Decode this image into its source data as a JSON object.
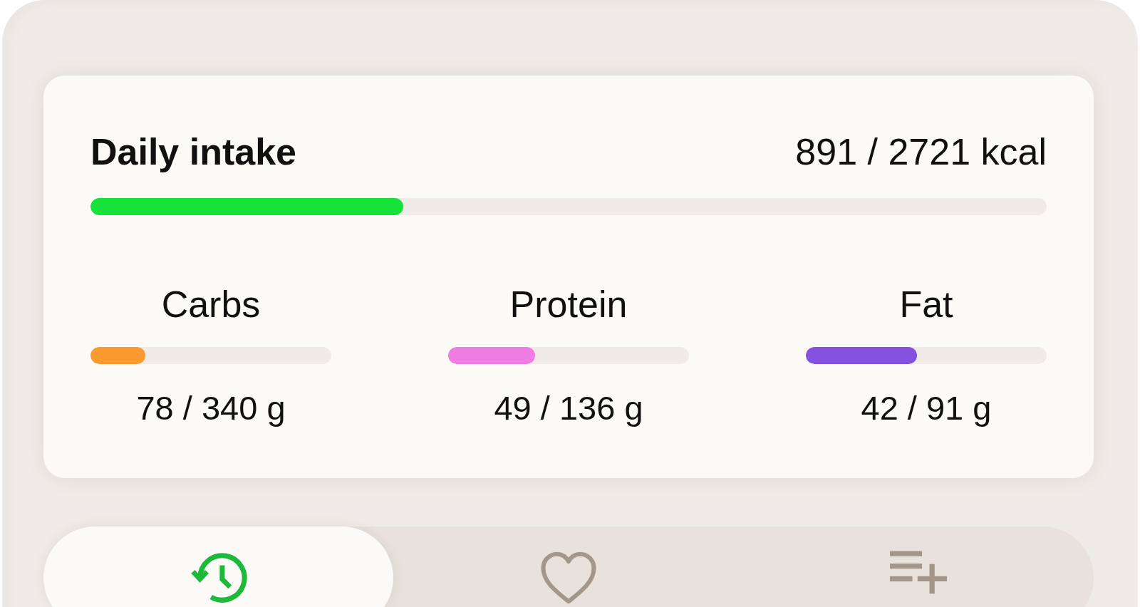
{
  "summary": {
    "title": "Daily intake",
    "reading": "891 / 2721 kcal",
    "level": 0.327
  },
  "macros": [
    {
      "name": "Carbs",
      "level": 0.229,
      "reading": "78 / 340 g",
      "color": "#fb9b2f"
    },
    {
      "name": "Protein",
      "level": 0.36,
      "reading": "49 / 136 g",
      "color": "#f07de3"
    },
    {
      "name": "Fat",
      "level": 0.462,
      "reading": "42 / 91 g",
      "color": "#8552df"
    }
  ],
  "tabs": [
    {
      "kind": "history",
      "selected": true
    },
    {
      "kind": "favorites",
      "selected": false
    },
    {
      "kind": "add-to-list",
      "selected": false
    }
  ]
}
